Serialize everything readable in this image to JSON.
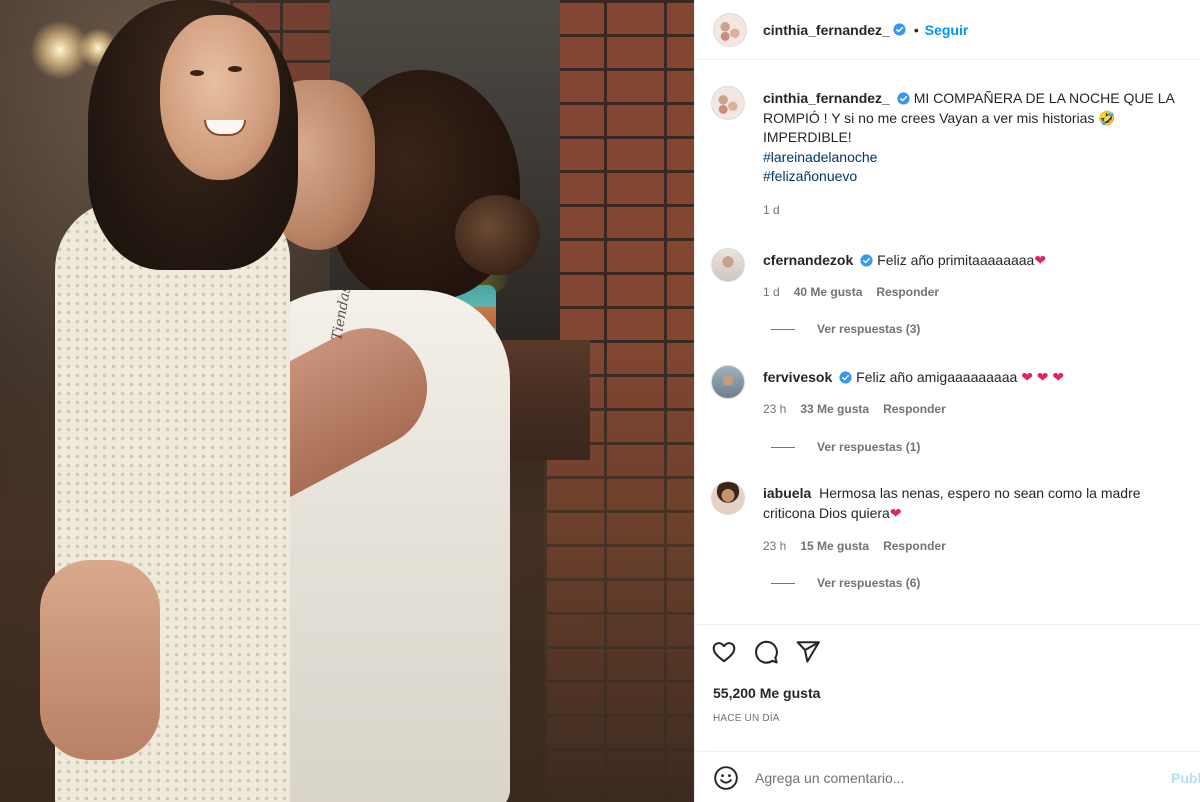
{
  "post": {
    "author": "cinthia_fernandez_",
    "follow_label": "Seguir",
    "separator": "•",
    "caption_lines": [
      "MI COMPAÑERA DE LA NOCHE QUE LA ROMPIÓ ! Y si no me crees Vayan a ver mis historias 🤣 IMPERDIBLE!"
    ],
    "hashtags": [
      "#lareinadelanoche",
      "#felizañonuevo"
    ],
    "caption_time": "1 d",
    "tattoo_text": "Tiendas"
  },
  "comments": [
    {
      "username": "cfernandezok",
      "verified": true,
      "text": "Feliz año primitaaaaaaaa",
      "hearts": "❤",
      "time": "1 d",
      "likes": "40 Me gusta",
      "reply": "Responder",
      "view_replies": "Ver respuestas (3)"
    },
    {
      "username": "fervivesok",
      "verified": true,
      "text": "Feliz año amigaaaaaaaaa",
      "hearts": "❤ ❤ ❤",
      "time": "23 h",
      "likes": "33 Me gusta",
      "reply": "Responder",
      "view_replies": "Ver respuestas (1)"
    },
    {
      "username": "iabuela",
      "verified": false,
      "text": "Hermosa las nenas, espero no sean como la madre criticona Dios quiera",
      "hearts": "❤",
      "time": "23 h",
      "likes": "15 Me gusta",
      "reply": "Responder",
      "view_replies": "Ver respuestas (6)"
    }
  ],
  "footer": {
    "likes_count": "55,200 Me gusta",
    "time_ago": "HACE UN DÍA",
    "comment_placeholder": "Agrega un comentario...",
    "publish_label": "Publicar"
  },
  "icons": {
    "like": "heart-icon",
    "comment": "comment-icon",
    "share": "share-icon",
    "emoji": "emoji-icon",
    "verified": "verified-badge-icon"
  },
  "colors": {
    "accent": "#0095f6",
    "hashtag": "#00376b",
    "muted": "#737373",
    "heart": "#e0245e",
    "verified": "#3897f0"
  }
}
